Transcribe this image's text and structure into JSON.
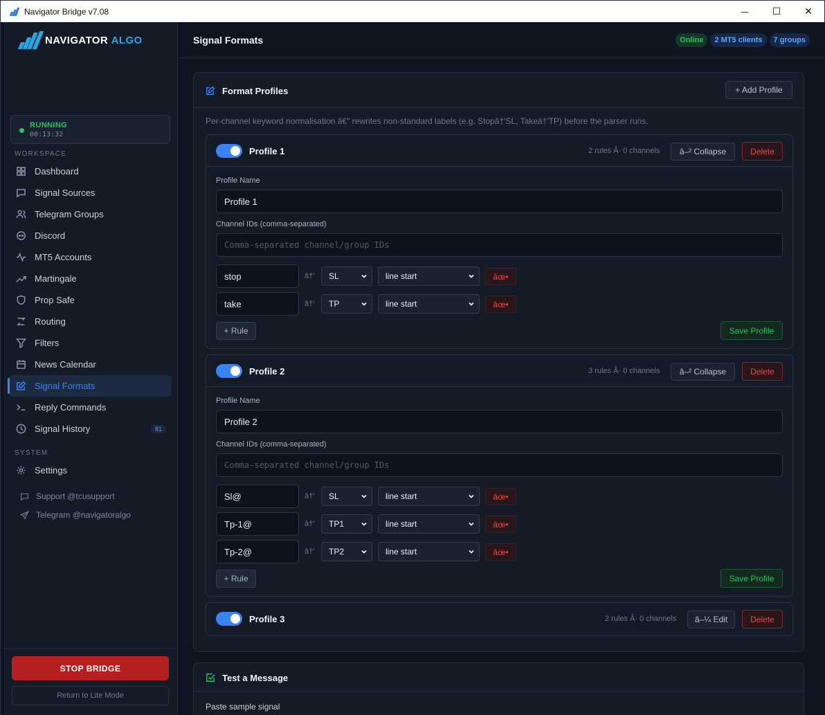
{
  "window": {
    "title": "Navigator Bridge v7.08",
    "controls": [
      "─",
      "☐",
      "✕"
    ]
  },
  "brand": {
    "name_a": "NAVIGATOR",
    "name_b": "ALGO"
  },
  "status": {
    "label": "RUNNING",
    "uptime": "00:13:32"
  },
  "sections": {
    "workspace": "WORKSPACE",
    "system": "SYSTEM"
  },
  "nav": [
    {
      "label": "Dashboard",
      "icon": "grid-icon"
    },
    {
      "label": "Signal Sources",
      "icon": "message-icon"
    },
    {
      "label": "Telegram Groups",
      "icon": "users-icon"
    },
    {
      "label": "Discord",
      "icon": "discord-icon"
    },
    {
      "label": "MT5 Accounts",
      "icon": "activity-icon"
    },
    {
      "label": "Martingale",
      "icon": "trend-icon"
    },
    {
      "label": "Prop Safe",
      "icon": "shield-icon"
    },
    {
      "label": "Routing",
      "icon": "route-icon"
    },
    {
      "label": "Filters",
      "icon": "filter-icon"
    },
    {
      "label": "News Calendar",
      "icon": "calendar-icon"
    },
    {
      "label": "Signal Formats",
      "icon": "edit-icon",
      "active": true
    },
    {
      "label": "Reply Commands",
      "icon": "terminal-icon"
    },
    {
      "label": "Signal History",
      "icon": "clock-icon",
      "badge": "81"
    }
  ],
  "system_nav": [
    {
      "label": "Settings",
      "icon": "gear-icon"
    }
  ],
  "support": {
    "support": "Support @tcusupport",
    "telegram": "Telegram @navigatoralgo"
  },
  "footer": {
    "stop": "STOP BRIDGE",
    "lite": "Return to Lite Mode"
  },
  "header": {
    "title": "Signal Formats",
    "pills": {
      "online": "Online",
      "clients": "2 MT5 clients",
      "groups": "7 groups"
    }
  },
  "profiles_card": {
    "title": "Format Profiles",
    "add": "+ Add Profile",
    "desc": "Per-channel keyword normalisation â€\" rewrites non-standard labels (e.g. Stopâ†'SL, Takeâ†'TP) before the parser runs.",
    "labels": {
      "name": "Profile Name",
      "channels": "Channel IDs (comma-separated)",
      "channels_ph": "Comma-separated channel/group IDs",
      "arrow": "â†'",
      "remove": "âœ•",
      "add_rule": "+ Rule",
      "save": "Save Profile",
      "delete": "Delete",
      "collapse": "â–² Collapse",
      "edit": "â–¼ Edit"
    },
    "profiles": [
      {
        "name": "Profile 1",
        "meta": "2 rules Â· 0 channels",
        "field": "Profile 1",
        "rules": [
          {
            "kw": "stop",
            "target": "SL",
            "pos": "line start"
          },
          {
            "kw": "take",
            "target": "TP",
            "pos": "line start"
          }
        ]
      },
      {
        "name": "Profile 2",
        "meta": "3 rules Â· 0 channels",
        "field": "Profile 2",
        "rules": [
          {
            "kw": "Sl@",
            "target": "SL",
            "pos": "line start"
          },
          {
            "kw": "Tp-1@",
            "target": "TP1",
            "pos": "line start"
          },
          {
            "kw": "Tp-2@",
            "target": "TP2",
            "pos": "line start"
          }
        ]
      },
      {
        "name": "Profile 3",
        "meta": "2 rules Â· 0 channels"
      }
    ]
  },
  "test_card": {
    "title": "Test a Message",
    "paste": "Paste sample signal"
  },
  "colors": {
    "accent": "#3b82f6",
    "success": "#22c55e",
    "danger": "#ef4444",
    "brand": "#2aa6e0"
  }
}
